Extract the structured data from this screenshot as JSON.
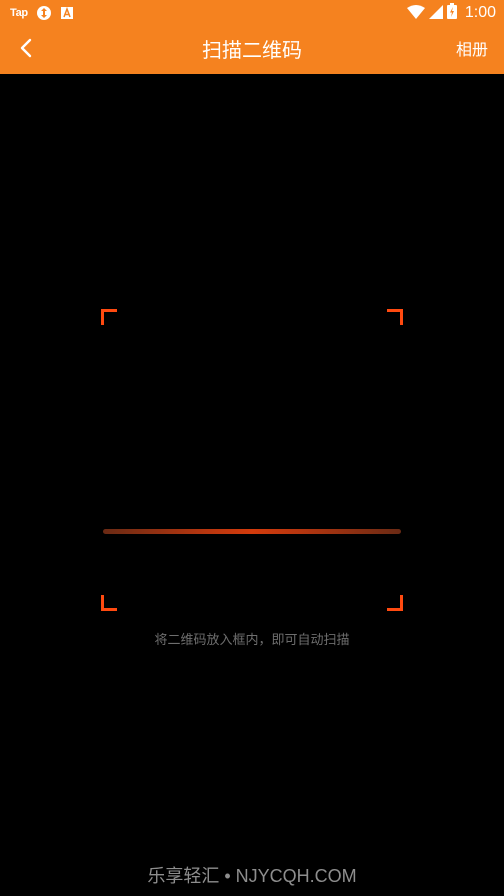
{
  "status_bar": {
    "app_label": "Tap",
    "time": "1:00",
    "icons": [
      "tap-app-icon",
      "sync-icon",
      "font-app-icon",
      "wifi-icon",
      "cell-signal-icon",
      "battery-charging-icon"
    ]
  },
  "toolbar": {
    "title": "扫描二维码",
    "right_label": "相册",
    "back_icon": "chevron-left-icon"
  },
  "scanner": {
    "hint": "将二维码放入框内，即可自动扫描",
    "scan_line_progress": 0.74,
    "accent_color": "#ff4a10"
  },
  "watermark": "乐享轻汇 • NJYCQH.COM",
  "colors": {
    "primary": "#f5821f",
    "background": "#000000",
    "hint_text": "#6e6e6e"
  }
}
